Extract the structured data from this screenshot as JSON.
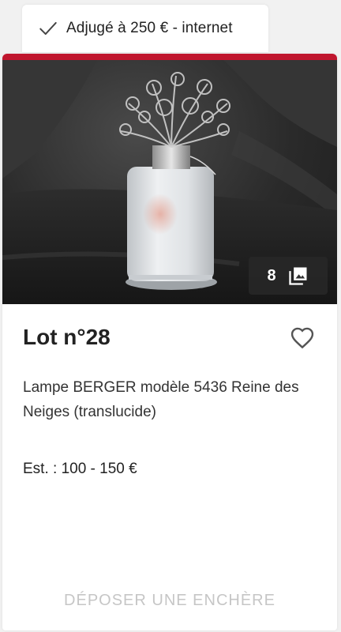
{
  "status": {
    "label": "Adjugé à 250 € - internet",
    "icon": "check-icon"
  },
  "lot": {
    "title": "Lot n°28",
    "description": "Lampe BERGER modèle 5436 Reine des Neiges (translucide)",
    "estimate": "Est. : 100 - 150 €",
    "photo_count": "8",
    "photo_icon": "gallery-icon",
    "favorite_icon": "heart-outline-icon",
    "bid_label": "DÉPOSER UNE ENCHÈRE"
  },
  "colors": {
    "accent": "#c0162e",
    "disabled_text": "#c6c6c6"
  }
}
